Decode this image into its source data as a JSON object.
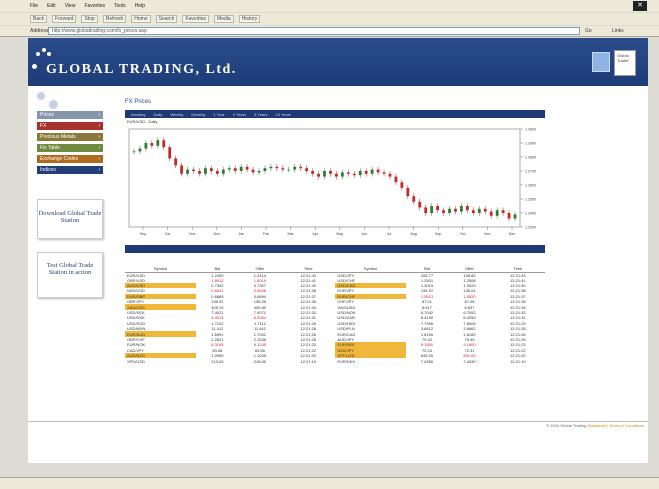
{
  "browser": {
    "menu": [
      "File",
      "Edit",
      "View",
      "Favorites",
      "Tools",
      "Help"
    ],
    "toolbar": [
      "Back",
      "Forward",
      "Stop",
      "Refresh",
      "Home",
      "Search",
      "Favorites",
      "Media",
      "History"
    ],
    "address_label": "Address",
    "address_value": "http://www.globaltrading.com/fx_prices.asp",
    "go_label": "Go",
    "links_label": "Links"
  },
  "header": {
    "brand": "GLOBAL TRADING, Ltd.",
    "badge_text": "Global Trader"
  },
  "sidebar": {
    "items": [
      {
        "label": "Prices",
        "color": "#8896ad"
      },
      {
        "label": "FX",
        "color": "#a8322d"
      },
      {
        "label": "Precious Metals",
        "color": "#8a7a3a"
      },
      {
        "label": "Fix Table",
        "color": "#6f8a3d"
      },
      {
        "label": "Exchange Codes",
        "color": "#b06a1f"
      },
      {
        "label": "Indices",
        "color": "#223e7a"
      }
    ],
    "promos": [
      {
        "text": "Download Global Trade Station"
      },
      {
        "text": "Test Global Trade Station in action"
      }
    ]
  },
  "main": {
    "title": "FX Prices",
    "chart_tabs": [
      "Intraday",
      "Daily",
      "Weekly",
      "Monthly",
      "1 Year",
      "2 Years",
      "5 Years",
      "10 Years"
    ],
    "chart_subtitle": "EUR/USD - Daily",
    "lower_bar_text": ""
  },
  "chart_data": {
    "type": "line",
    "x_ticks": [
      "Sep",
      "Oct",
      "Nov",
      "Dec",
      "Jan",
      "Feb",
      "Mar",
      "Apr",
      "May",
      "Jun",
      "Jul",
      "Aug",
      "Sep",
      "Oct",
      "Nov",
      "Dec"
    ],
    "y_ticks": [
      "1.3000",
      "1.2900",
      "1.2800",
      "1.2700",
      "1.2600",
      "1.2500",
      "1.2400",
      "1.2300"
    ],
    "ylim": [
      1.23,
      1.3
    ],
    "values": [
      1.284,
      1.286,
      1.29,
      1.288,
      1.292,
      1.287,
      1.279,
      1.274,
      1.268,
      1.271,
      1.27,
      1.268,
      1.272,
      1.27,
      1.268,
      1.271,
      1.272,
      1.27,
      1.273,
      1.271,
      1.269,
      1.27,
      1.272,
      1.273,
      1.272,
      1.271,
      1.271,
      1.273,
      1.272,
      1.27,
      1.268,
      1.266,
      1.27,
      1.268,
      1.266,
      1.269,
      1.268,
      1.267,
      1.27,
      1.268,
      1.271,
      1.269,
      1.268,
      1.266,
      1.262,
      1.258,
      1.252,
      1.248,
      1.244,
      1.24,
      1.245,
      1.242,
      1.24,
      1.243,
      1.241,
      1.245,
      1.242,
      1.24,
      1.243,
      1.241,
      1.238,
      1.242,
      1.24,
      1.236,
      1.239
    ],
    "colors": {
      "up": "#2e7d32",
      "down": "#c62828"
    }
  },
  "table": {
    "headers": [
      "Symbol",
      "Bid",
      "Offer",
      "Time",
      "Symbol",
      "Bid",
      "Offer",
      "Time"
    ],
    "rows": [
      [
        {
          "v": "EUR/USD"
        },
        {
          "v": "1.2409"
        },
        {
          "v": "1.2414"
        },
        {
          "v": "12:21:43"
        },
        {
          "v": "USD/JPY"
        },
        {
          "v": "108.77"
        },
        {
          "v": "108.82"
        },
        {
          "v": "12:21:43"
        }
      ],
      [
        {
          "v": "GBP/USD"
        },
        {
          "v": "1.8012",
          "neg": true
        },
        {
          "v": "1.8019",
          "neg": true
        },
        {
          "v": "12:21:41"
        },
        {
          "v": "USD/CHF"
        },
        {
          "v": "1.2501"
        },
        {
          "v": "1.2508"
        },
        {
          "v": "12:21:41"
        }
      ],
      [
        {
          "v": "AUD/USD",
          "hl": true
        },
        {
          "v": "0.7302"
        },
        {
          "v": "0.7307"
        },
        {
          "v": "12:21:40"
        },
        {
          "v": "USD/CAD",
          "hl": true
        },
        {
          "v": "1.3015"
        },
        {
          "v": "1.3020"
        },
        {
          "v": "12:21:40"
        }
      ],
      [
        {
          "v": "NZD/USD"
        },
        {
          "v": "0.6641",
          "neg": true
        },
        {
          "v": "0.6648",
          "neg": true
        },
        {
          "v": "12:21:38"
        },
        {
          "v": "EUR/JPY"
        },
        {
          "v": "134.97"
        },
        {
          "v": "135.04"
        },
        {
          "v": "12:21:38"
        }
      ],
      [
        {
          "v": "EUR/GBP",
          "hl": true
        },
        {
          "v": "0.6889"
        },
        {
          "v": "0.6894"
        },
        {
          "v": "12:21:37"
        },
        {
          "v": "EUR/CHF",
          "hl": true
        },
        {
          "v": "1.5513",
          "neg": true
        },
        {
          "v": "1.5520",
          "neg": true
        },
        {
          "v": "12:21:37"
        }
      ],
      [
        {
          "v": "GBP/JPY"
        },
        {
          "v": "195.92"
        },
        {
          "v": "196.05"
        },
        {
          "v": "12:21:35"
        },
        {
          "v": "CHF/JPY"
        },
        {
          "v": "87.01"
        },
        {
          "v": "87.08"
        },
        {
          "v": "12:21:35"
        }
      ],
      [
        {
          "v": "XAU/USD",
          "hl": true
        },
        {
          "v": "405.10"
        },
        {
          "v": "405.60"
        },
        {
          "v": "12:21:34"
        },
        {
          "v": "XAG/USD"
        },
        {
          "v": "6.617"
        },
        {
          "v": "6.637"
        },
        {
          "v": "12:21:34"
        }
      ],
      [
        {
          "v": "USD/SEK"
        },
        {
          "v": "7.4021"
        },
        {
          "v": "7.4071"
        },
        {
          "v": "12:21:32"
        },
        {
          "v": "USD/NOK"
        },
        {
          "v": "6.7042"
        },
        {
          "v": "6.7092"
        },
        {
          "v": "12:21:32"
        }
      ],
      [
        {
          "v": "USD/DKK"
        },
        {
          "v": "6.0014",
          "neg": true
        },
        {
          "v": "6.0064",
          "neg": true
        },
        {
          "v": "12:21:31"
        },
        {
          "v": "USD/ZAR"
        },
        {
          "v": "6.4150"
        },
        {
          "v": "6.4250"
        },
        {
          "v": "12:21:31"
        }
      ],
      [
        {
          "v": "USD/SGD"
        },
        {
          "v": "1.7102"
        },
        {
          "v": "1.7112"
        },
        {
          "v": "12:21:29"
        },
        {
          "v": "USD/HKD"
        },
        {
          "v": "7.7996"
        },
        {
          "v": "7.8006"
        },
        {
          "v": "12:21:29"
        }
      ],
      [
        {
          "v": "USD/MXN"
        },
        {
          "v": "11.412"
        },
        {
          "v": "11.442"
        },
        {
          "v": "12:21:28"
        },
        {
          "v": "USD/PLN"
        },
        {
          "v": "3.6612"
        },
        {
          "v": "3.6662"
        },
        {
          "v": "12:21:28"
        }
      ],
      [
        {
          "v": "EUR/AUD",
          "hl": true
        },
        {
          "v": "1.6991"
        },
        {
          "v": "1.7001"
        },
        {
          "v": "12:21:26"
        },
        {
          "v": "EUR/CAD"
        },
        {
          "v": "1.6150"
        },
        {
          "v": "1.6160"
        },
        {
          "v": "12:21:26"
        }
      ],
      [
        {
          "v": "GBP/CHF"
        },
        {
          "v": "2.2521"
        },
        {
          "v": "2.2536"
        },
        {
          "v": "12:21:25"
        },
        {
          "v": "AUD/JPY"
        },
        {
          "v": "79.42"
        },
        {
          "v": "79.49"
        },
        {
          "v": "12:21:25"
        }
      ],
      [
        {
          "v": "EUR/NOK"
        },
        {
          "v": "8.3195",
          "neg": true
        },
        {
          "v": "8.3245",
          "neg": true
        },
        {
          "v": "12:21:23"
        },
        {
          "v": "EUR/SEK",
          "hl": true
        },
        {
          "v": "9.1850",
          "neg": true
        },
        {
          "v": "9.1900",
          "neg": true
        },
        {
          "v": "12:21:23"
        }
      ],
      [
        {
          "v": "CAD/JPY"
        },
        {
          "v": "83.58"
        },
        {
          "v": "83.65"
        },
        {
          "v": "12:21:22"
        },
        {
          "v": "NZD/JPY",
          "hl": true
        },
        {
          "v": "72.24"
        },
        {
          "v": "72.31"
        },
        {
          "v": "12:21:22"
        }
      ],
      [
        {
          "v": "AUD/NZD",
          "hl": true
        },
        {
          "v": "1.0995"
        },
        {
          "v": "1.1005"
        },
        {
          "v": "12:21:20"
        },
        {
          "v": "XPT/USD",
          "hl": true
        },
        {
          "v": "846.00"
        },
        {
          "v": "851.00",
          "neg": true
        },
        {
          "v": "12:21:20"
        }
      ],
      [
        {
          "v": "XPD/USD"
        },
        {
          "v": "213.00"
        },
        {
          "v": "218.00"
        },
        {
          "v": "12:21:19"
        },
        {
          "v": "EUR/DKK"
        },
        {
          "v": "7.4380"
        },
        {
          "v": "7.4430"
        },
        {
          "v": "12:21:19"
        }
      ]
    ]
  },
  "footer": {
    "copyright": "© 2004 Global Trading",
    "links": "Disclaimer | Terms & Conditions"
  }
}
